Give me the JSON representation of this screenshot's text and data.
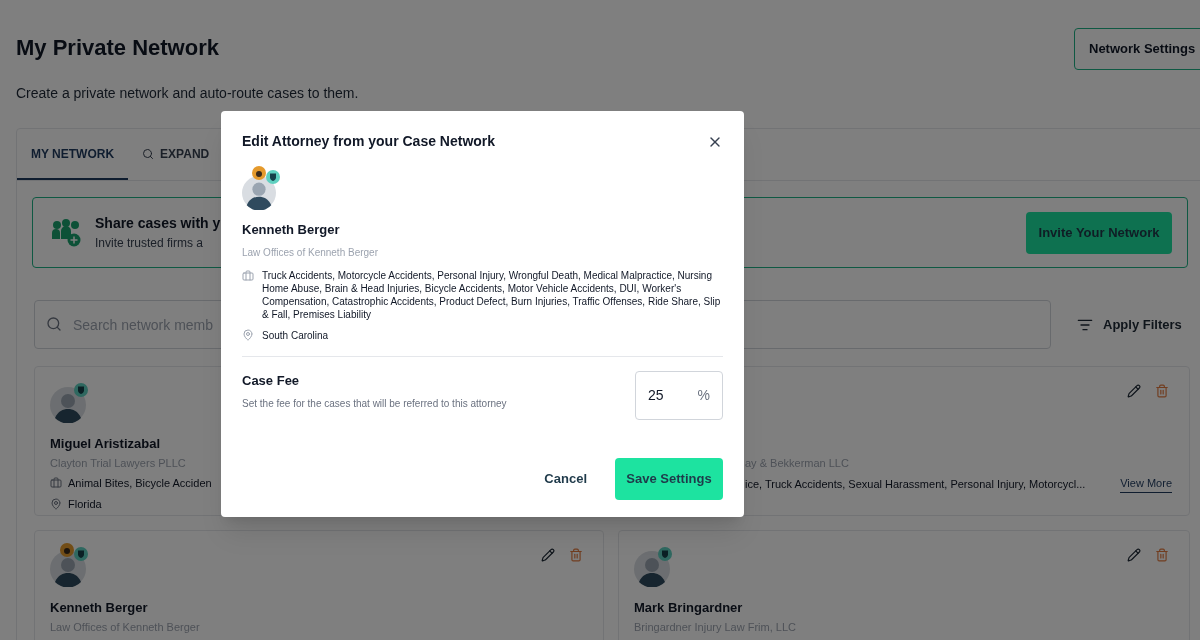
{
  "page": {
    "title": "My Private Network",
    "subtitle": "Create a private network and auto-route cases to them.",
    "settings_button": "Network Settings"
  },
  "tabs": [
    {
      "label": "MY NETWORK",
      "selected": true,
      "kind": "plain"
    },
    {
      "label": "EXPAND",
      "selected": false,
      "kind": "search"
    }
  ],
  "banner": {
    "title": "Share cases with y",
    "text": "Invite trusted firms a",
    "button": "Invite Your Network"
  },
  "search": {
    "placeholder": "Search network memb",
    "filter_button": "Apply Filters"
  },
  "members": [
    {
      "kind": "left_visible",
      "name": "Miguel Aristizabal",
      "firm": "Clayton Trial Lawyers PLLC",
      "practice": "Animal Bites, Bicycle Acciden",
      "location": "Florida",
      "actions": false,
      "award": false
    },
    {
      "kind": "right_visible",
      "firm": "ay & Bekkerman LLC",
      "practice": "ice, Truck Accidents, Sexual Harassment, Personal Injury, Motorcycl...",
      "view_more": "View More",
      "actions": true
    },
    {
      "kind": "full",
      "name": "Kenneth Berger",
      "firm": "Law Offices of Kenneth Berger",
      "actions": true,
      "award": true
    },
    {
      "kind": "full",
      "name": "Mark Bringardner",
      "firm": "Bringardner Injury Law Frim, LLC",
      "actions": true,
      "award": false
    }
  ],
  "modal": {
    "title": "Edit Attorney from your Case Network",
    "award": true,
    "name": "Kenneth Berger",
    "firm": "Law Offices of Kenneth Berger",
    "practice": "Truck Accidents, Motorcycle Accidents, Personal Injury, Wrongful Death, Medical Malpractice, Nursing Home Abuse, Brain & Head Injuries, Bicycle Accidents, Motor Vehicle Accidents, DUI, Worker's Compensation, Catastrophic Accidents, Product Defect, Burn Injuries, Traffic Offenses, Ride Share, Slip & Fall, Premises Liability",
    "location": "South Carolina",
    "fee_label": "Case Fee",
    "fee_hint": "Set the fee for the cases that will be referred to this attorney",
    "fee_value": "25",
    "fee_unit": "%",
    "cancel": "Cancel",
    "save": "Save Settings"
  }
}
